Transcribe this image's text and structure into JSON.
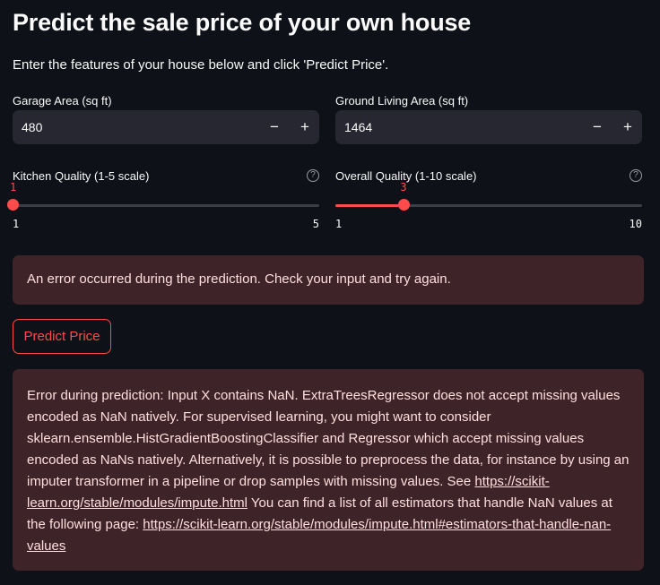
{
  "page": {
    "title": "Predict the sale price of your own house",
    "subtitle": "Enter the features of your house below and click 'Predict Price'."
  },
  "inputs": {
    "garage_area": {
      "label": "Garage Area (sq ft)",
      "value": "480",
      "minus": "−",
      "plus": "+"
    },
    "ground_living_area": {
      "label": "Ground Living Area (sq ft)",
      "value": "1464",
      "minus": "−",
      "plus": "+"
    }
  },
  "sliders": {
    "kitchen_quality": {
      "label": "Kitchen Quality (1-5 scale)",
      "value": 1,
      "value_label": "1",
      "min": 1,
      "max": 5,
      "min_label": "1",
      "max_label": "5",
      "help_icon": "question-circle"
    },
    "overall_quality": {
      "label": "Overall Quality (1-10 scale)",
      "value": 3,
      "value_label": "3",
      "min": 1,
      "max": 10,
      "min_label": "1",
      "max_label": "10",
      "help_icon": "question-circle"
    }
  },
  "alerts": {
    "general_error": "An error occurred during the prediction. Check your input and try again.",
    "detail_text_1": "Error during prediction: Input X contains NaN. ExtraTreesRegressor does not accept missing values encoded as NaN natively. For supervised learning, you might want to consider sklearn.ensemble.HistGradientBoostingClassifier and Regressor which accept missing values encoded as NaNs natively. Alternatively, it is possible to preprocess the data, for instance by using an imputer transformer in a pipeline or drop samples with missing values. See ",
    "detail_link_1": "https://scikit-learn.org/stable/modules/impute.html",
    "detail_text_2": " You can find a list of all estimators that handle NaN values at the following page: ",
    "detail_link_2": "https://scikit-learn.org/stable/modules/impute.html#estimators-that-handle-nan-values"
  },
  "buttons": {
    "predict": "Predict Price"
  },
  "colors": {
    "accent": "#ff4b4b",
    "background": "#0e1117",
    "input_bg": "#262730",
    "error_bg": "#3e2428"
  }
}
